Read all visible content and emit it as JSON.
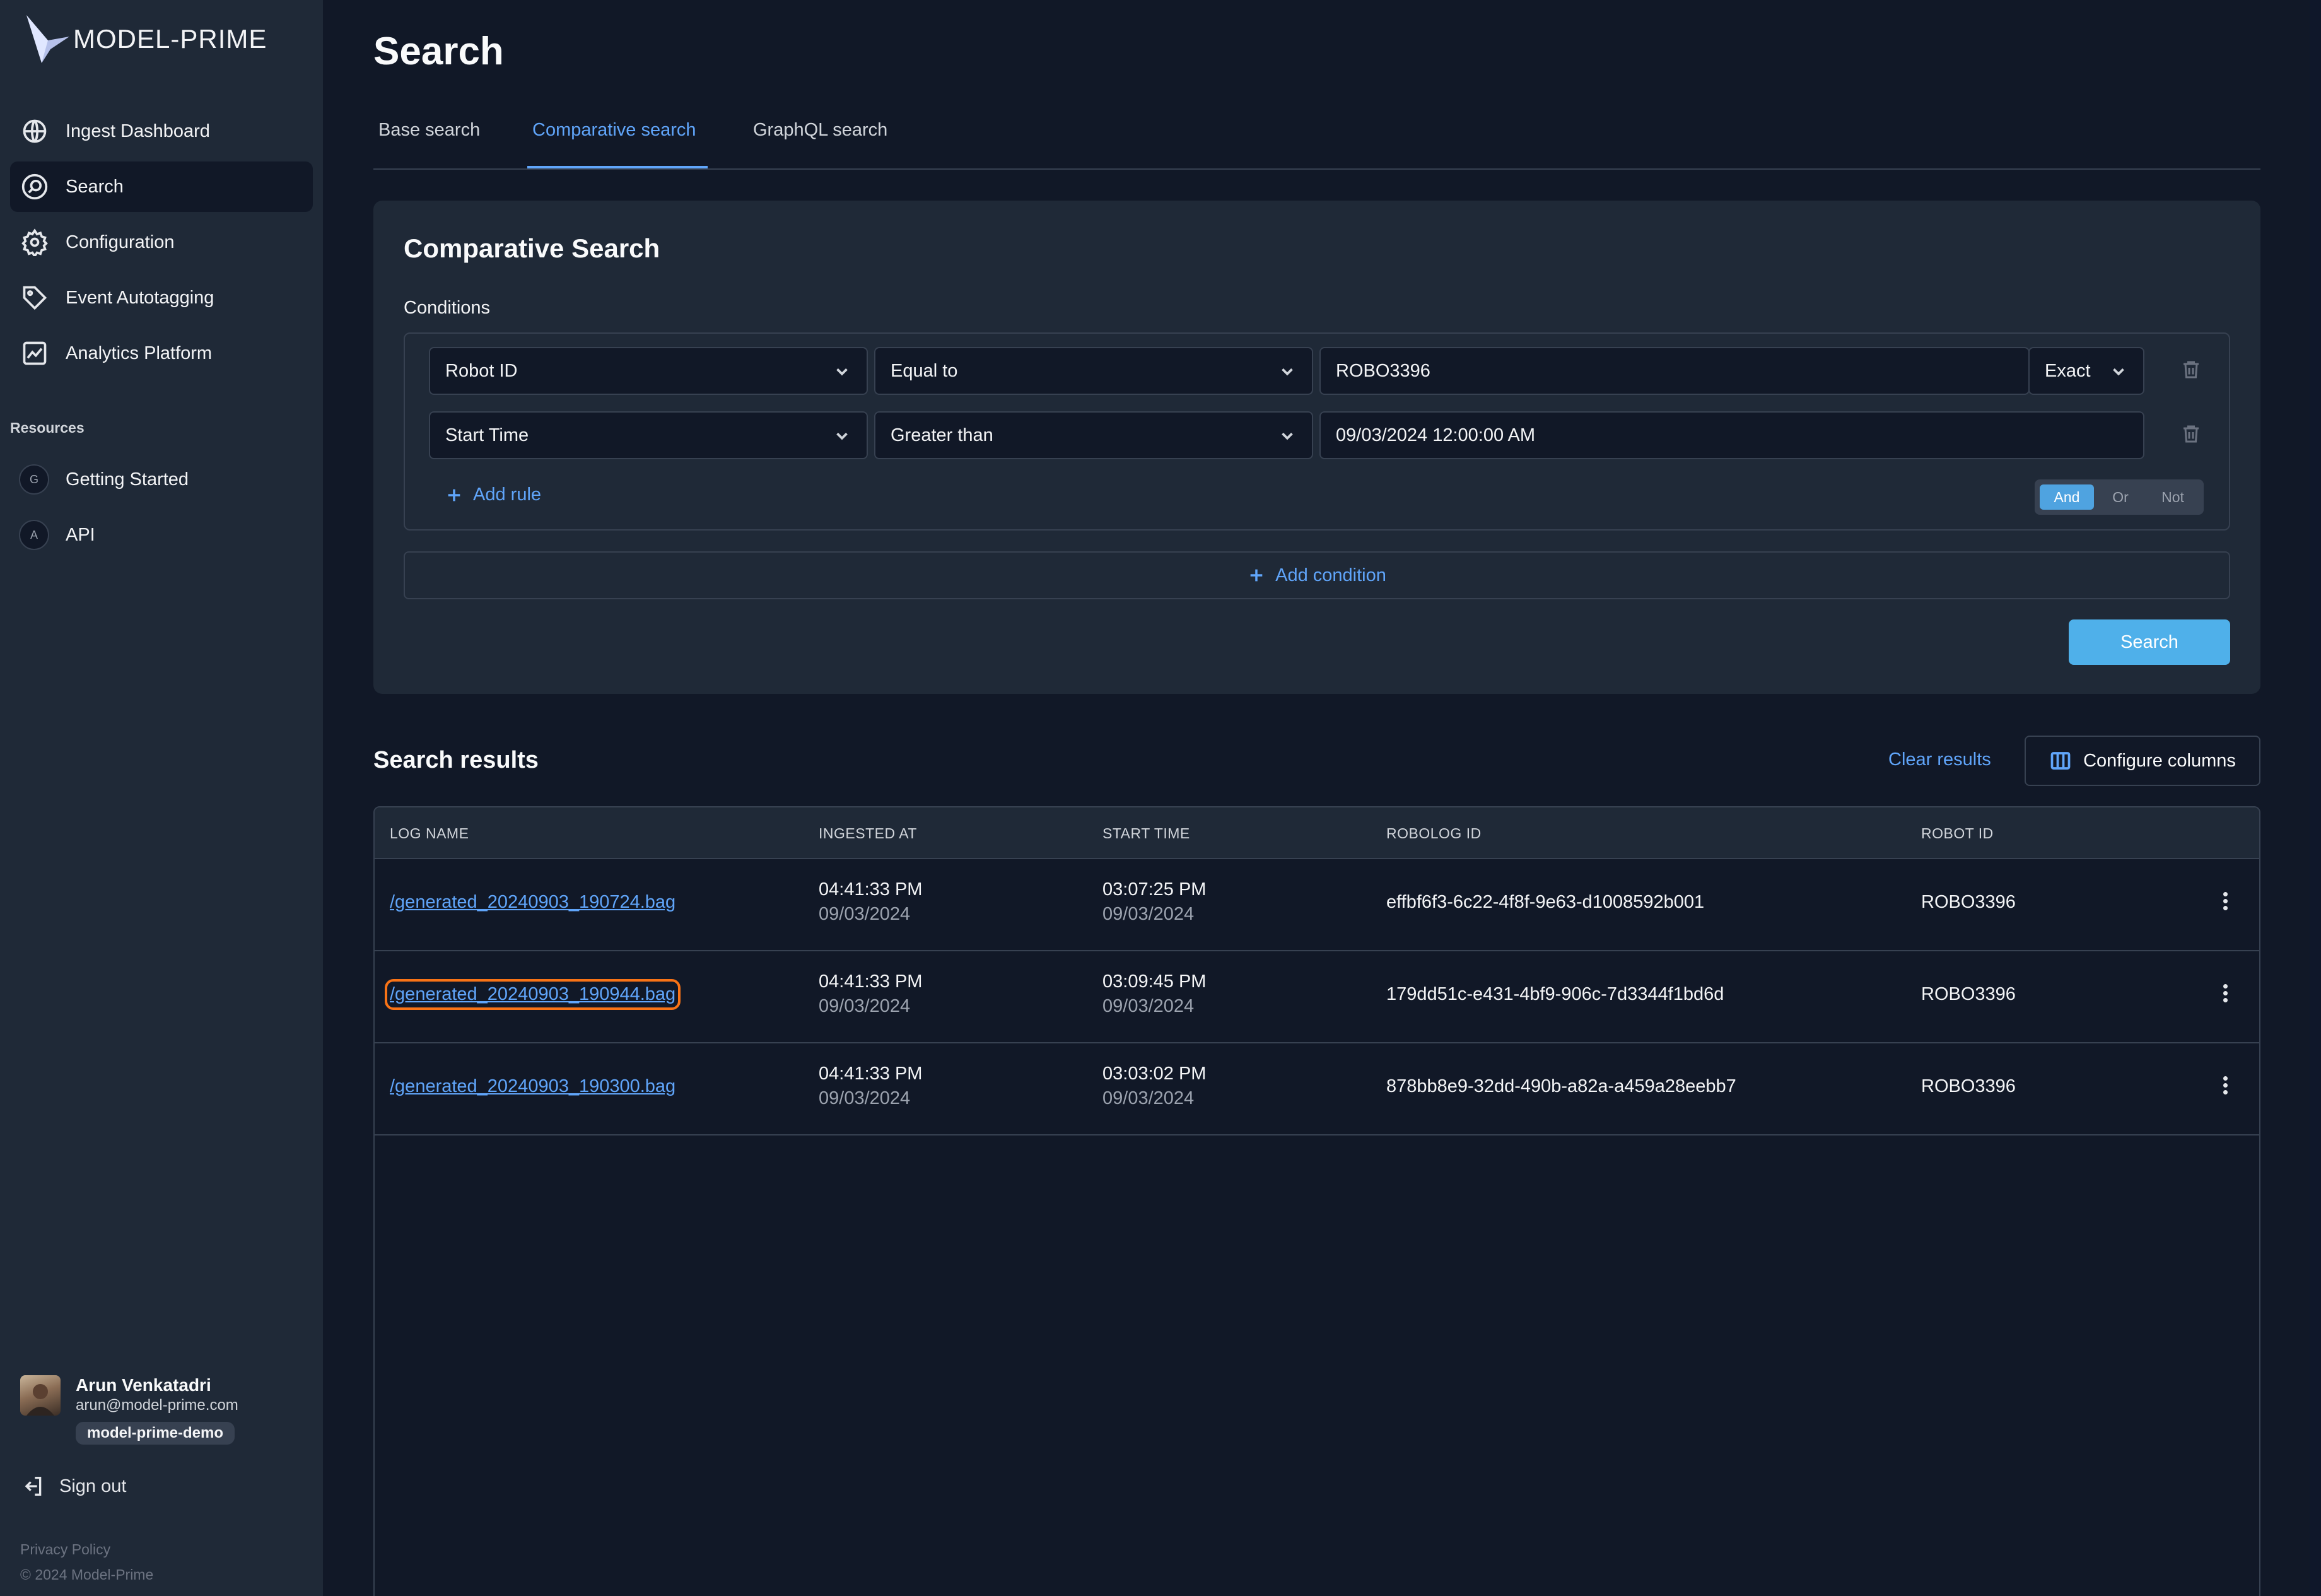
{
  "app": {
    "logo_text": "MODEL-PRIME"
  },
  "sidebar": {
    "items": [
      {
        "label": "Ingest Dashboard",
        "icon": "globe-icon"
      },
      {
        "label": "Search",
        "icon": "search-icon"
      },
      {
        "label": "Configuration",
        "icon": "gear-icon"
      },
      {
        "label": "Event Autotagging",
        "icon": "tag-icon"
      },
      {
        "label": "Analytics Platform",
        "icon": "chart-icon"
      }
    ],
    "resources_label": "Resources",
    "resources": [
      {
        "badge": "G",
        "label": "Getting Started"
      },
      {
        "badge": "A",
        "label": "API"
      }
    ],
    "user": {
      "name": "Arun Venkatadri",
      "email": "arun@model-prime.com",
      "org": "model-prime-demo"
    },
    "signout_label": "Sign out",
    "privacy_label": "Privacy Policy",
    "copyright": "© 2024 Model-Prime"
  },
  "page": {
    "title": "Search",
    "tabs": [
      {
        "label": "Base search"
      },
      {
        "label": "Comparative search"
      },
      {
        "label": "GraphQL search"
      }
    ]
  },
  "comparative": {
    "title": "Comparative Search",
    "conditions_label": "Conditions",
    "rules": [
      {
        "field": "Robot ID",
        "operator": "Equal to",
        "value": "ROBO3396",
        "match": "Exact"
      },
      {
        "field": "Start Time",
        "operator": "Greater than",
        "value": "09/03/2024 12:00:00 AM"
      }
    ],
    "add_rule_label": "Add rule",
    "logic": [
      "And",
      "Or",
      "Not"
    ],
    "logic_selected": "And",
    "add_condition_label": "Add condition",
    "search_button": "Search"
  },
  "results": {
    "title": "Search results",
    "clear_label": "Clear results",
    "configure_label": "Configure columns",
    "columns": [
      "LOG NAME",
      "INGESTED AT",
      "START TIME",
      "ROBOLOG ID",
      "ROBOT ID"
    ],
    "rows": [
      {
        "log_name": "/generated_20240903_190724.bag",
        "ingested_time": "04:41:33 PM",
        "ingested_date": "09/03/2024",
        "start_time": "03:07:25 PM",
        "start_date": "09/03/2024",
        "robolog_id": "effbf6f3-6c22-4f8f-9e63-d1008592b001",
        "robot_id": "ROBO3396"
      },
      {
        "log_name": "/generated_20240903_190944.bag",
        "ingested_time": "04:41:33 PM",
        "ingested_date": "09/03/2024",
        "start_time": "03:09:45 PM",
        "start_date": "09/03/2024",
        "robolog_id": "179dd51c-e431-4bf9-906c-7d3344f1bd6d",
        "robot_id": "ROBO3396"
      },
      {
        "log_name": "/generated_20240903_190300.bag",
        "ingested_time": "04:41:33 PM",
        "ingested_date": "09/03/2024",
        "start_time": "03:03:02 PM",
        "start_date": "09/03/2024",
        "robolog_id": "878bb8e9-32dd-490b-a82a-a459a28eebb7",
        "robot_id": "ROBO3396"
      }
    ]
  },
  "colors": {
    "accent": "#60a5fa",
    "background": "#111827",
    "sidebar": "#1f2937",
    "primary_button": "#4fb0ea",
    "focus_ring": "#f97316"
  }
}
